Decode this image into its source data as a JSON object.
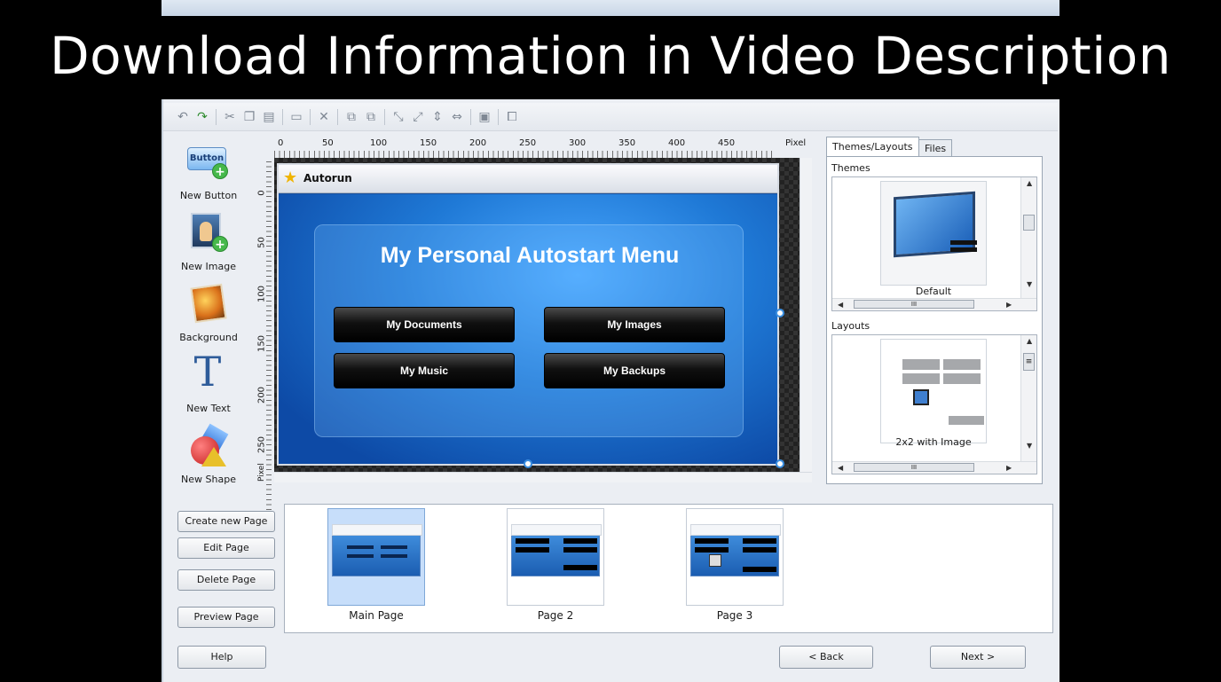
{
  "banner": {
    "title": "Download Information in Video Description"
  },
  "toolbar": {
    "buttons": [
      "undo-icon",
      "redo-icon",
      "cut-icon",
      "copy-icon",
      "paste-icon",
      "page-icon",
      "delete-icon",
      "align-left-icon",
      "align-right-icon",
      "arrange-icon",
      "distribute-v-icon",
      "distribute-h-icon",
      "lock-icon",
      "group-icon"
    ]
  },
  "tools": [
    {
      "label": "New Button",
      "icon_text": "Button"
    },
    {
      "label": "New Image"
    },
    {
      "label": "Background"
    },
    {
      "label": "New Text",
      "icon_text": "T"
    },
    {
      "label": "New Shape"
    }
  ],
  "ruler": {
    "top_ticks": [
      "0",
      "50",
      "100",
      "150",
      "200",
      "250",
      "300",
      "350",
      "400",
      "450"
    ],
    "top_unit": "Pixel",
    "left_ticks": [
      "0",
      "50",
      "100",
      "150",
      "200",
      "250"
    ],
    "left_unit": "Pixel"
  },
  "canvas": {
    "window_title": "Autorun",
    "menu_title": "My Personal Autostart Menu",
    "buttons": [
      "My Documents",
      "My Images",
      "My Music",
      "My Backups"
    ]
  },
  "right_panel": {
    "tabs": [
      "Themes/Layouts",
      "Files"
    ],
    "themes_label": "Themes",
    "theme_name": "Default",
    "layouts_label": "Layouts",
    "layout_name": "2x2 with Image",
    "hscroll_glyph": "III",
    "vscroll_glyph": "≡"
  },
  "pages": {
    "buttons": [
      "Create new Page",
      "Edit Page",
      "Delete Page",
      "Preview Page"
    ],
    "items": [
      "Main Page",
      "Page 2",
      "Page 3"
    ],
    "selected": "Main Page"
  },
  "nav": {
    "help": "Help",
    "back": "< Back",
    "next": "Next >"
  },
  "colors": {
    "accent": "#1f79d6",
    "button_dark": "#101010",
    "banner_bg": "#000000",
    "banner_text": "#ffffff"
  }
}
